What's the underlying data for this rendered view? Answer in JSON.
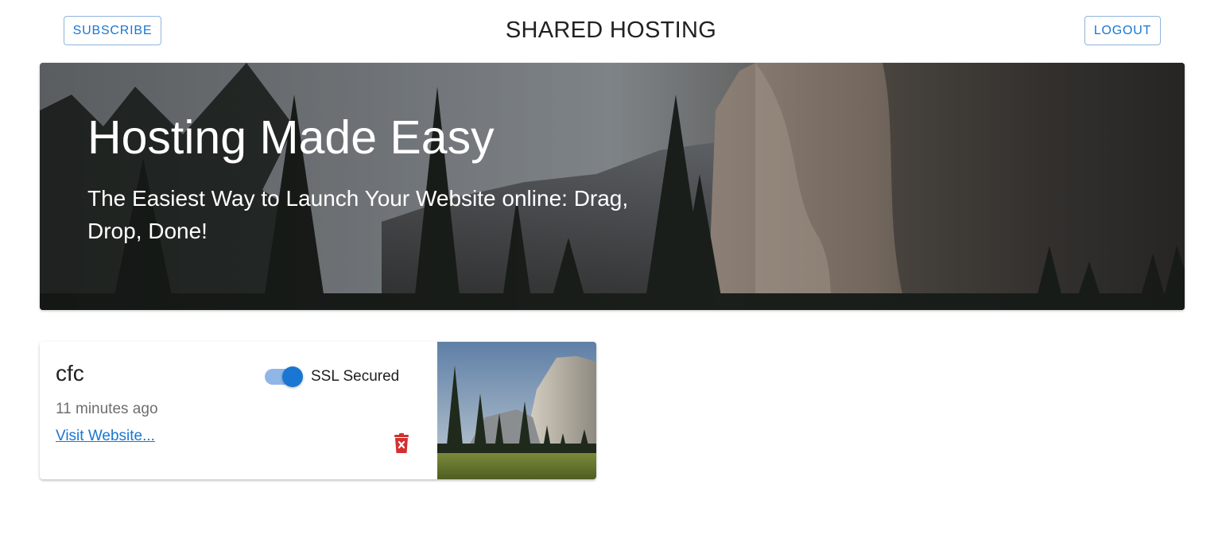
{
  "header": {
    "subscribe_label": "SUBSCRIBE",
    "title": "SHARED HOSTING",
    "logout_label": "LOGOUT"
  },
  "hero": {
    "title": "Hosting Made Easy",
    "subtitle": "The Easiest Way to Launch Your Website online: Drag, Drop, Done!"
  },
  "sites": [
    {
      "name": "cfc",
      "time": "11 minutes ago",
      "link_text": "Visit Website...",
      "ssl_label": "SSL Secured",
      "ssl_enabled": true
    }
  ],
  "colors": {
    "primary": "#1976d2",
    "delete": "#d32f2f"
  },
  "icons": {
    "delete": "trash-x-icon"
  }
}
